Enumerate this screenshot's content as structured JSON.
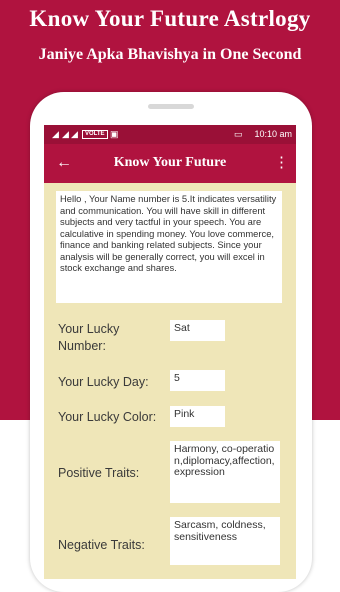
{
  "promo": {
    "title": "Know Your Future Astrlogy",
    "subtitle": "Janiye Apka Bhavishya in One Second",
    "brand_color": "#b0133f"
  },
  "statusbar": {
    "volte": "VOLTE",
    "time": "10:10 am",
    "color": "#9a1037"
  },
  "appbar": {
    "title": "Know Your Future",
    "back_icon": "arrow-back-icon",
    "menu_icon": "more-vertical-icon"
  },
  "description": "Hello , Your Name number is 5.It indicates versatility and communication. You will have skill in different subjects and very tactful in your speech. You are calculative in spending money. You love commerce, finance and banking related subjects. Since your analysis will be generally correct, you will excel in stock exchange and shares.",
  "fields": [
    {
      "label": "Your Lucky Number:",
      "value": "Sat"
    },
    {
      "label": "Your Lucky Day:",
      "value": "5"
    },
    {
      "label": "Your Lucky Color:",
      "value": "Pink"
    },
    {
      "label": "Positive Traits:",
      "value": "Harmony, co-operation,diplomacy,affection, expression"
    },
    {
      "label": "Negative Traits:",
      "value": "Sarcasm, coldness, sensitiveness"
    }
  ],
  "screen_bg": "#efe6b8"
}
